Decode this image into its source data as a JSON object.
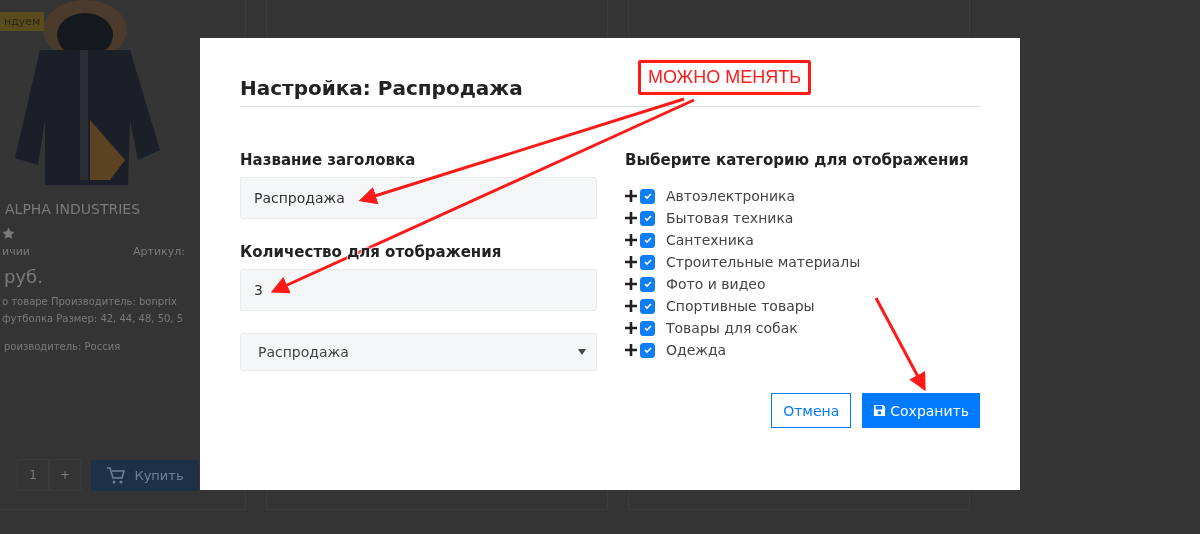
{
  "background_page": {
    "badge": "ндуем",
    "product": {
      "title": "ALPHA INDUSTRIES",
      "availability": "ичии",
      "article": "Артикул:",
      "price": "руб.",
      "description": [
        "о товаре Производитель: bonprix",
        "футболка Размер: 42, 44, 48, 50, 5"
      ],
      "country": "роизводитель: Россия",
      "quantity": "1",
      "plus": "+",
      "buy_button": "Купить"
    }
  },
  "modal": {
    "title": "Настройка: Распродажа",
    "heading_field": {
      "label": "Название заголовка",
      "value": "Распродажа"
    },
    "count_field": {
      "label": "Количество для отображения",
      "value": "3"
    },
    "select": {
      "value": "Распродажа"
    },
    "categories_title": "Выберите категорию для отображения",
    "categories": [
      {
        "label": "Автоэлектроника",
        "checked": true
      },
      {
        "label": "Бытовая техника",
        "checked": true
      },
      {
        "label": "Сантехника",
        "checked": true
      },
      {
        "label": "Строительные материалы",
        "checked": true
      },
      {
        "label": "Фото и видео",
        "checked": true
      },
      {
        "label": "Спортивные товары",
        "checked": true
      },
      {
        "label": "Товары для собак",
        "checked": true
      },
      {
        "label": "Одежда",
        "checked": true
      }
    ],
    "buttons": {
      "cancel": "Отмена",
      "save": "Сохранить"
    }
  },
  "annotation": {
    "note": "МОЖНО МЕНЯТЬ"
  }
}
